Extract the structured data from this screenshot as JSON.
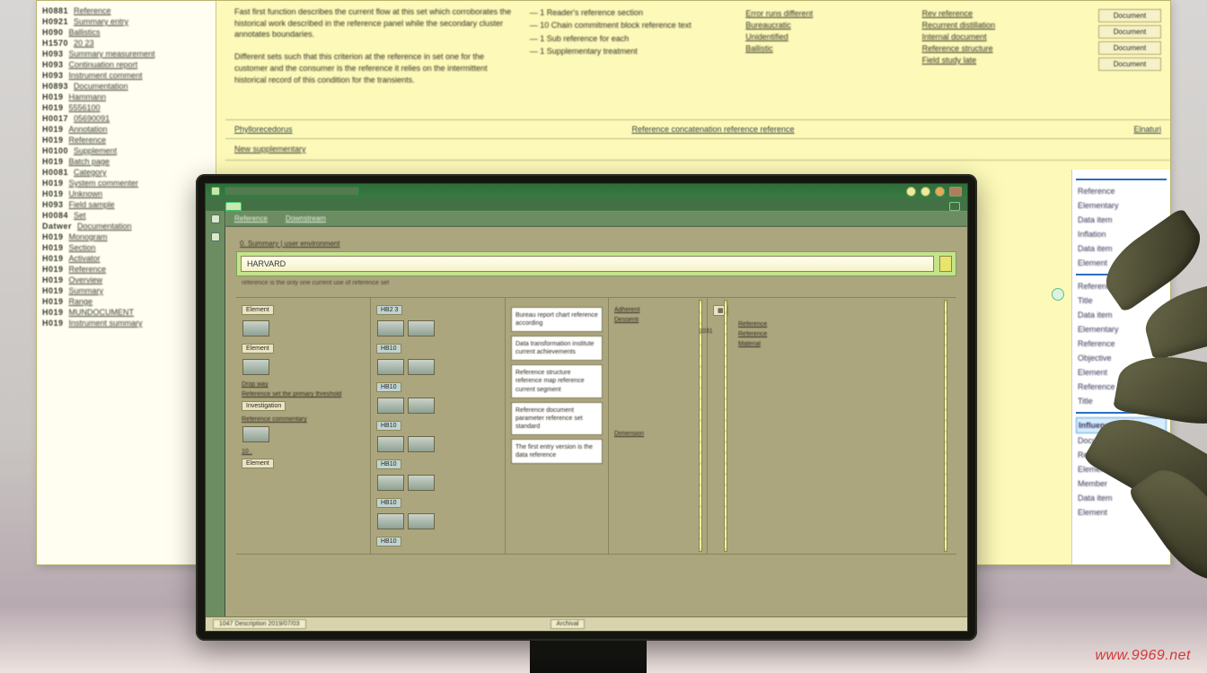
{
  "bg": {
    "index": [
      {
        "code": "H0881",
        "t": "Reference"
      },
      {
        "code": "H0921",
        "t": "Summary entry"
      },
      {
        "code": "H090",
        "t": "Ballistics"
      },
      {
        "code": "H1570",
        "t": "20 23"
      },
      {
        "code": "H093",
        "t": "Summary measurement"
      },
      {
        "code": "H093",
        "t": "Continuation report"
      },
      {
        "code": "H093",
        "t": "Instrument comment"
      },
      {
        "code": "H0893",
        "t": "Documentation"
      },
      {
        "code": "H019",
        "t": "Hammann"
      },
      {
        "code": "H019",
        "t": "5556100"
      },
      {
        "code": "H0017",
        "t": "05690091"
      },
      {
        "code": "H019",
        "t": "Annotation"
      },
      {
        "code": "H019",
        "t": "Reference"
      },
      {
        "code": "H0100",
        "t": "Supplement"
      },
      {
        "code": "H019",
        "t": "Batch page"
      },
      {
        "code": "H0081",
        "t": "Category"
      },
      {
        "code": "H019",
        "t": "System commenter"
      },
      {
        "code": "H019",
        "t": "Unknown"
      },
      {
        "code": "H093",
        "t": "Field sample"
      },
      {
        "code": "H0084",
        "t": "Set"
      },
      {
        "code": "Datwer",
        "t": "Documentation"
      },
      {
        "code": "H019",
        "t": "Monogram"
      },
      {
        "code": "H019",
        "t": "Section"
      },
      {
        "code": "H019",
        "t": "Activator"
      },
      {
        "code": "H019",
        "t": "Reference"
      },
      {
        "code": "H019",
        "t": "Overview"
      },
      {
        "code": "H019",
        "t": "Summary"
      },
      {
        "code": "H019",
        "t": "Range"
      },
      {
        "code": "H019",
        "t": "MUNDOCUMENT"
      },
      {
        "code": "H019",
        "t": "Instrument summary"
      }
    ],
    "para1": "Fast first function describes the current flow at this set which corroborates the historical work described in the reference panel while the secondary cluster annotates boundaries.",
    "para2": "Different sets such that this criterion at the reference in set one for the customer and the consumer is the reference it relies on the intermittent historical record of this condition for the transients.",
    "list": [
      "1  Reader's reference section",
      "10  Chain commitment  block reference text",
      "1  Sub reference for each",
      "1  Supplementary treatment"
    ],
    "links": [
      "Error runs different",
      "Bureaucratic",
      "Unidentified",
      "Ballistic"
    ],
    "refs": [
      "Rev reference",
      "Recurrent distillation",
      "Internal document",
      "Reference structure",
      "Field study late"
    ],
    "btns": [
      "Document",
      "Document",
      "Document",
      "Document"
    ],
    "bar_left": "Phyllorecedorus",
    "bar_mid": "Reference concatenation reference reference",
    "bar_right": "Elnaturi",
    "bar2": "New supplementary",
    "right_items": [
      "Reference",
      "Elementary",
      "Data item",
      "Inflation",
      "Data item",
      "Element",
      "Reference",
      "Title",
      "Data item",
      "Elementary",
      "Reference",
      "Objective",
      "Element",
      "Reference",
      "Title",
      "Influence",
      "Document",
      "Reference",
      "Element",
      "Member",
      "Data item",
      "Element"
    ]
  },
  "app": {
    "toolbar": [
      "Reference",
      "Downstream"
    ],
    "section_label": "0. Summary | user environment",
    "search_value": "HARVARD",
    "under_hint": "reference  is the only one current use of reference set",
    "col1": {
      "chips": [
        "Element",
        "Element"
      ],
      "caption": "Drop way",
      "note": "Reference set the primary threshold",
      "label2": "Investigation",
      "label2b": "Reference commentary",
      "num": "10 .",
      "tag": "Element"
    },
    "col2": {
      "head": "HB2 3",
      "sets": [
        [
          "",
          ""
        ],
        [
          "",
          ""
        ],
        [
          "",
          ""
        ],
        [
          "",
          ""
        ],
        [
          "",
          ""
        ],
        [
          "",
          ""
        ]
      ],
      "labels": [
        "HB10",
        "HB10",
        "HB10",
        "HB10",
        "HB10",
        "HB10"
      ]
    },
    "col3": {
      "blocks": [
        "Bureau report chart\nreference according",
        "Data transformation\ninstitute current\nachievements",
        "Reference structure\nreference map reference\ncurrent segment",
        "Reference document\nparameter reference\nset standard",
        "The first entry version is\nthe data reference"
      ]
    },
    "col4": {
      "labels": [
        "Adherent",
        "Dessenti",
        "Dimension"
      ]
    },
    "ruler_label": "1031",
    "col5": {
      "labels": [
        "Reference",
        "Reference",
        "Material"
      ]
    },
    "status": {
      "left": "1047  Description  2019/07/03",
      "mid": "Archival"
    }
  },
  "watermark": "www.9969.net"
}
